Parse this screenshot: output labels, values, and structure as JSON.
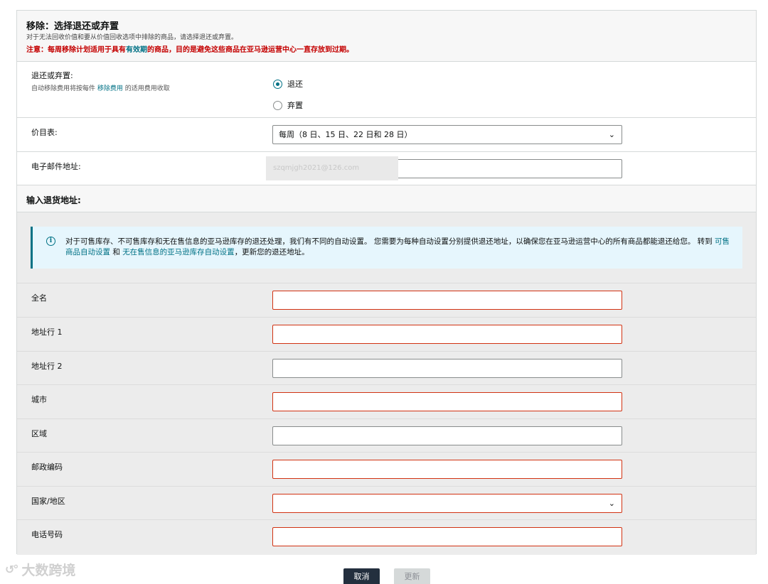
{
  "header": {
    "title": "移除：选择退还或弃置",
    "description": "对于无法回收价值和要从价值回收选项中排除的商品，请选择退还或弃置。",
    "warning_before": "注意：每周移除计划适用于具有",
    "warning_link": "有效期",
    "warning_after": "的商品，目的是避免这些商品在亚马逊运营中心一直存放到过期。"
  },
  "disposition": {
    "label": "退还或弃置:",
    "sub_before": "自动移除费用将按每件",
    "sub_link": "移除费用",
    "sub_after": "的适用费用收取",
    "options": [
      "退还",
      "弃置"
    ],
    "selected": "退还"
  },
  "schedule": {
    "label": "价目表:",
    "value": "每周（8 日、15 日、22 日和 28 日）"
  },
  "email": {
    "label": "电子邮件地址:",
    "value": "szqmjgh2021@126.com"
  },
  "address": {
    "title": "输入退货地址:",
    "info_before": "对于可售库存、不可售库存和无在售信息的亚马逊库存的退还处理，我们有不同的自动设置。 您需要为每种自动设置分别提供退还地址，以确保您在亚马逊运营中心的所有商品都能退还给您。 转到",
    "info_link1": "可售商品自动设置",
    "info_mid": "和",
    "info_link2": "无在售信息的亚马逊库存自动设置",
    "info_after": "，更新您的退还地址。",
    "fields": {
      "full_name": "全名",
      "address1": "地址行 1",
      "address2": "地址行 2",
      "city": "城市",
      "region": "区域",
      "postal": "邮政编码",
      "country": "国家/地区",
      "phone": "电话号码"
    }
  },
  "buttons": {
    "cancel": "取消",
    "update": "更新"
  },
  "watermark": {
    "text": "大数跨境"
  },
  "colors": {
    "accent": "#007185",
    "error": "#d13212",
    "warning": "#c40000",
    "primary_button": "#232f3e"
  }
}
